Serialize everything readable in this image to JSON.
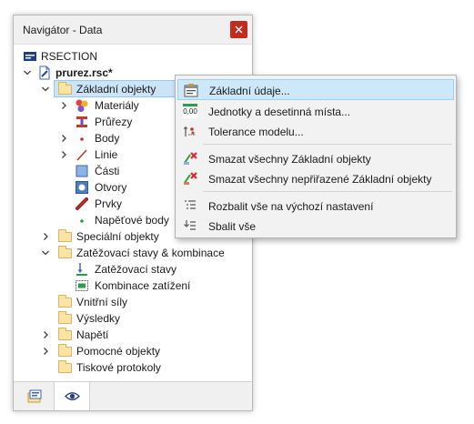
{
  "panel": {
    "title": "Navigátor - Data",
    "close_icon": "close-icon"
  },
  "tree": {
    "root": "RSECTION",
    "file": "prurez.rsc*",
    "basic": "Základní objekty",
    "materials": "Materiály",
    "sections": "Průřezy",
    "points": "Body",
    "lines": "Linie",
    "parts": "Části",
    "openings": "Otvory",
    "elements": "Prvky",
    "stress_points": "Napěťové body",
    "special": "Speciální objekty",
    "load_cases_group": "Zatěžovací stavy & kombinace",
    "load_cases": "Zatěžovací stavy",
    "load_combinations": "Kombinace zatížení",
    "internal_forces": "Vnitřní síly",
    "results": "Výsledky",
    "stresses": "Napětí",
    "guide_objects": "Pomocné objekty",
    "printouts": "Tiskové protokoly"
  },
  "menu": {
    "basic_data": "Základní údaje...",
    "units": "Jednotky a desetinná místa...",
    "units_icon_text": "0,00",
    "tolerance": "Tolerance modelu...",
    "delete_all": "Smazat všechny Základní objekty",
    "delete_unassigned": "Smazat všechny nepřiřazené Základní objekty",
    "expand_default": "Rozbalit vše na výchozí nastavení",
    "collapse_all": "Sbalit vše"
  },
  "colors": {
    "selection": "#cce4f7",
    "menu_highlight": "#cde8fb",
    "close_button": "#c42b1c",
    "folder": "#fbe3a3"
  }
}
